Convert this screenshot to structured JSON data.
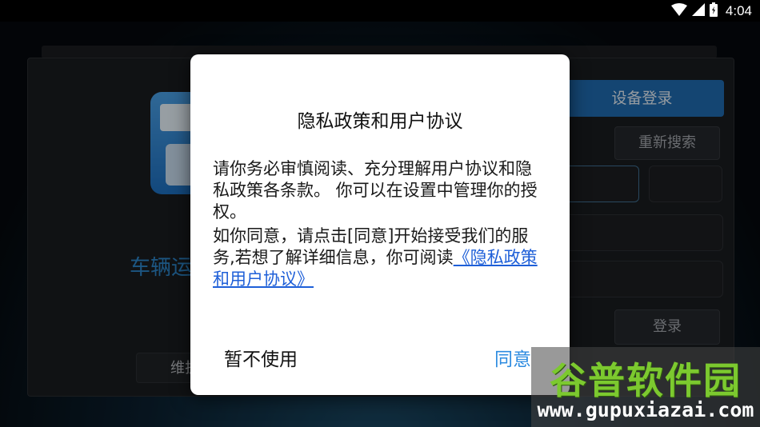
{
  "status_bar": {
    "time": "4:04",
    "icons": [
      "wifi-icon",
      "cell-signal-icon",
      "battery-icon"
    ]
  },
  "background_app": {
    "title_partial": "车辆运",
    "device_login_label": "设备登录",
    "research_label": "重新搜索",
    "login_label": "登录",
    "maintenance_label_partial": "维护"
  },
  "dialog": {
    "title": "隐私政策和用户协议",
    "paragraph1": "请你务必审慎阅读、充分理解用户协议和隐私政策各条款。 你可以在设置中管理你的授权。",
    "paragraph2_prefix": "如你同意，请点击[同意]开始接受我们的服务,若想了解详细信息，你可阅读",
    "paragraph2_link": "《隐私政策和用户协议》",
    "decline_label": "暂不使用",
    "agree_label": "同意"
  },
  "watermark": {
    "brand": "谷普软件园",
    "url": "www.gupuxiazai.com"
  },
  "colors": {
    "link": "#1e5fd8",
    "agree_button": "#2c8be0",
    "device_login_bg": "#1f6bb0",
    "watermark_brand": "#7cc92f"
  }
}
